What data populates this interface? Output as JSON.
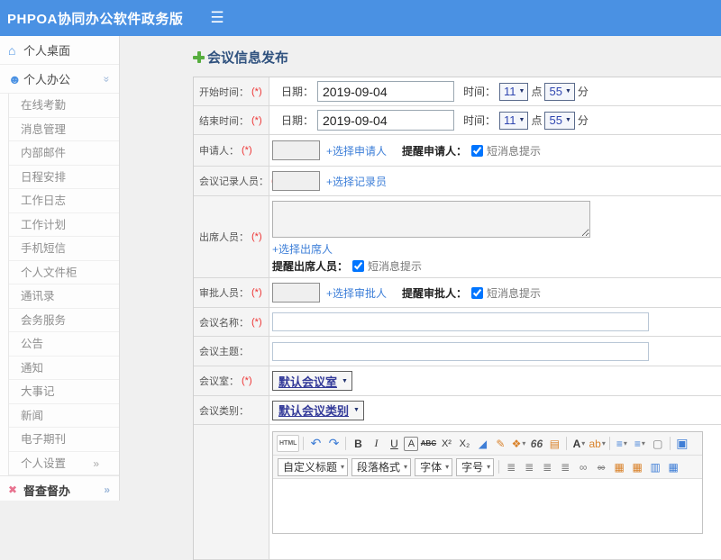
{
  "icons": {
    "menu-icon": "☰",
    "home-icon": "⌂",
    "user-icon": "☻",
    "chevrons-down-icon": "»",
    "chevron-right-icon": "»",
    "crossed-arrows-icon": "✖",
    "dropdown-arrow-icon": "▼"
  },
  "colors": {
    "header_bg": "#4a91e3",
    "link_blue": "#3e7fd8",
    "title_navy": "#30527f",
    "required_red": "#ee3333",
    "main_bg": "#f0f0f0"
  },
  "header": {
    "app_title": "PHPOA协同办公软件政务版"
  },
  "sidebar": {
    "desktop": {
      "label": "个人桌面"
    },
    "personal_office": {
      "label": "个人办公",
      "items": [
        {
          "name": "sidebar-item-online-attendance",
          "label": "在线考勤"
        },
        {
          "name": "sidebar-item-message-management",
          "label": "消息管理"
        },
        {
          "name": "sidebar-item-internal-mail",
          "label": "内部邮件"
        },
        {
          "name": "sidebar-item-schedule",
          "label": "日程安排"
        },
        {
          "name": "sidebar-item-work-log",
          "label": "工作日志"
        },
        {
          "name": "sidebar-item-work-plan",
          "label": "工作计划"
        },
        {
          "name": "sidebar-item-mobile-sms",
          "label": "手机短信"
        },
        {
          "name": "sidebar-item-personal-file-cabinet",
          "label": "个人文件柜"
        },
        {
          "name": "sidebar-item-contacts",
          "label": "通讯录"
        },
        {
          "name": "sidebar-item-meeting-services",
          "label": "会务服务"
        },
        {
          "name": "sidebar-item-announcement",
          "label": "公告"
        },
        {
          "name": "sidebar-item-notice",
          "label": "通知"
        },
        {
          "name": "sidebar-item-major-events",
          "label": "大事记"
        },
        {
          "name": "sidebar-item-news",
          "label": "新闻"
        },
        {
          "name": "sidebar-item-e-journal",
          "label": "电子期刊"
        },
        {
          "name": "sidebar-item-personal-settings",
          "label": "个人设置",
          "chevron": "»"
        }
      ]
    },
    "supervision": {
      "label": "督查督办",
      "chevron": "»"
    }
  },
  "page": {
    "title": "会议信息发布"
  },
  "form": {
    "start_time": {
      "label": "开始时间：",
      "required": "(*)",
      "date_label": "日期：",
      "date_value": "2019-09-04",
      "time_label": "时间：",
      "hour": "11",
      "hour_unit": "点",
      "minute": "55",
      "minute_unit": "分"
    },
    "end_time": {
      "label": "结束时间：",
      "required": "(*)",
      "date_label": "日期：",
      "date_value": "2019-09-04",
      "time_label": "时间：",
      "hour": "11",
      "hour_unit": "点",
      "minute": "55",
      "minute_unit": "分"
    },
    "applicant": {
      "label": "申请人：",
      "required": "(*)",
      "value": "",
      "pick_link": "+选择申请人",
      "remind_label": "提醒申请人：",
      "checkbox_checked": true,
      "checkbox_label": "短消息提示"
    },
    "recorder": {
      "label": "会议记录人员：",
      "required": "(*)",
      "value": "",
      "pick_link": "+选择记录员"
    },
    "attendees": {
      "label": "出席人员：",
      "required": "(*)",
      "value": "",
      "pick_link": "+选择出席人",
      "remind_label": "提醒出席人员：",
      "checkbox_checked": true,
      "checkbox_label": "短消息提示"
    },
    "approver": {
      "label": "审批人员：",
      "required": "(*)",
      "value": "",
      "pick_link": "+选择审批人",
      "remind_label": "提醒审批人：",
      "checkbox_checked": true,
      "checkbox_label": "短消息提示"
    },
    "meeting_name": {
      "label": "会议名称：",
      "required": "(*)",
      "value": ""
    },
    "meeting_topic": {
      "label": "会议主题：",
      "value": ""
    },
    "meeting_room": {
      "label": "会议室：",
      "required": "(*)",
      "selected": "默认会议室"
    },
    "meeting_category": {
      "label": "会议类别：",
      "selected": "默认会议类别"
    }
  },
  "editor": {
    "toolbar_row1": [
      {
        "name": "html-source-icon",
        "glyph": "HTML",
        "cls": "txt"
      },
      {
        "name": "separator",
        "glyph": "",
        "cls": "sep"
      },
      {
        "name": "undo-icon",
        "glyph": "↶",
        "cls": "blue big"
      },
      {
        "name": "redo-icon",
        "glyph": "↷",
        "cls": "blue big"
      },
      {
        "name": "separator",
        "glyph": "",
        "cls": "sep"
      },
      {
        "name": "bold-icon",
        "glyph": "B",
        "cls": "b"
      },
      {
        "name": "italic-icon",
        "glyph": "I",
        "cls": "i"
      },
      {
        "name": "underline-icon",
        "glyph": "U",
        "cls": "u"
      },
      {
        "name": "font-border-icon",
        "glyph": "A",
        "cls": "boxed"
      },
      {
        "name": "strikethrough-icon",
        "glyph": "ABC",
        "cls": "abc"
      },
      {
        "name": "superscript-icon",
        "glyph": "X²",
        "cls": "small"
      },
      {
        "name": "subscript-icon",
        "glyph": "X₂",
        "cls": "small"
      },
      {
        "name": "eraser-icon",
        "glyph": "◢",
        "cls": "blue"
      },
      {
        "name": "brush-icon",
        "glyph": "✎",
        "cls": "orange"
      },
      {
        "name": "palette-icon",
        "glyph": "❖",
        "cls": "orange drop"
      },
      {
        "name": "blockquote-icon",
        "glyph": "66",
        "cls": "quote"
      },
      {
        "name": "paste-icon",
        "glyph": "▤",
        "cls": "orange"
      },
      {
        "name": "separator",
        "glyph": "",
        "cls": "sep"
      },
      {
        "name": "font-color-icon",
        "glyph": "A",
        "cls": "b drop"
      },
      {
        "name": "highlight-color-icon",
        "glyph": "ab",
        "cls": "orange drop"
      },
      {
        "name": "separator",
        "glyph": "",
        "cls": "sep"
      },
      {
        "name": "ordered-list-icon",
        "glyph": "≡",
        "cls": "blue drop"
      },
      {
        "name": "unordered-list-icon",
        "glyph": "≡",
        "cls": "blue drop"
      },
      {
        "name": "new-document-icon",
        "glyph": "▢",
        "cls": "dim"
      },
      {
        "name": "separator",
        "glyph": "",
        "cls": "sep"
      },
      {
        "name": "fullscreen-icon",
        "glyph": "▣",
        "cls": "blue big"
      }
    ],
    "toolbar_row2_dropdowns": [
      {
        "name": "custom-heading-select",
        "label": "自定义标题"
      },
      {
        "name": "paragraph-format-select",
        "label": "段落格式"
      },
      {
        "name": "font-family-select",
        "label": "字体"
      },
      {
        "name": "font-size-select",
        "label": "字号"
      }
    ],
    "toolbar_row2_icons": [
      {
        "name": "align-left-icon",
        "glyph": "≣",
        "cls": "dim"
      },
      {
        "name": "align-center-icon",
        "glyph": "≣",
        "cls": "dim"
      },
      {
        "name": "align-right-icon",
        "glyph": "≣",
        "cls": "dim"
      },
      {
        "name": "align-justify-icon",
        "glyph": "≣",
        "cls": "dim"
      },
      {
        "name": "link-icon",
        "glyph": "∞",
        "cls": "dim"
      },
      {
        "name": "unlink-icon",
        "glyph": "∞",
        "cls": "dim strike"
      },
      {
        "name": "image-icon",
        "glyph": "▦",
        "cls": "orange"
      },
      {
        "name": "insert-image-icon",
        "glyph": "▦",
        "cls": "orange"
      },
      {
        "name": "page-layout-icon",
        "glyph": "▥",
        "cls": "blue"
      },
      {
        "name": "table-icon",
        "glyph": "▦",
        "cls": "blue"
      }
    ]
  }
}
